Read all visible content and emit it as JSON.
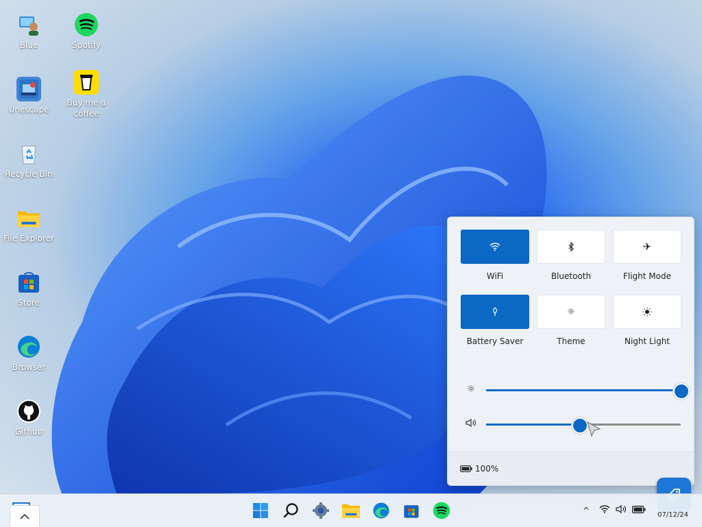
{
  "desktop": {
    "icons": [
      {
        "label": "Blue",
        "icon": "user-computer-icon"
      },
      {
        "label": "Spotify",
        "icon": "spotify-icon"
      },
      {
        "label": "Unescape",
        "icon": "unescape-app-icon"
      },
      {
        "label": "Buy me a coffee",
        "icon": "coffee-cup-icon"
      },
      {
        "label": "Recycle Bin",
        "icon": "recycle-bin-icon"
      },
      {
        "label": "File Explorer",
        "icon": "folder-icon"
      },
      {
        "label": "Store",
        "icon": "store-icon"
      },
      {
        "label": "Browser",
        "icon": "edge-browser-icon"
      },
      {
        "label": "Github",
        "icon": "github-icon"
      }
    ]
  },
  "quick_settings": {
    "tiles": [
      {
        "label": "WiFi",
        "active": true,
        "icon": "wifi-icon"
      },
      {
        "label": "Bluetooth",
        "active": false,
        "icon": "bluetooth-icon"
      },
      {
        "label": "Flight Mode",
        "active": false,
        "icon": "airplane-icon"
      },
      {
        "label": "Battery Saver",
        "active": true,
        "icon": "battery-saver-icon"
      },
      {
        "label": "Theme",
        "active": false,
        "icon": "theme-icon"
      },
      {
        "label": "Night Light",
        "active": false,
        "icon": "night-light-icon"
      }
    ],
    "brightness": {
      "value": 100,
      "icon": "brightness-icon"
    },
    "volume": {
      "value": 48,
      "icon": "volume-icon"
    },
    "battery_text": "100%",
    "accent": "#0b68c4"
  },
  "taskbar": {
    "apps": [
      "windows-start-icon",
      "search-icon",
      "settings-gear-icon",
      "file-explorer-icon",
      "edge-browser-icon",
      "store-icon",
      "spotify-icon"
    ],
    "clock": "07/12/24"
  }
}
